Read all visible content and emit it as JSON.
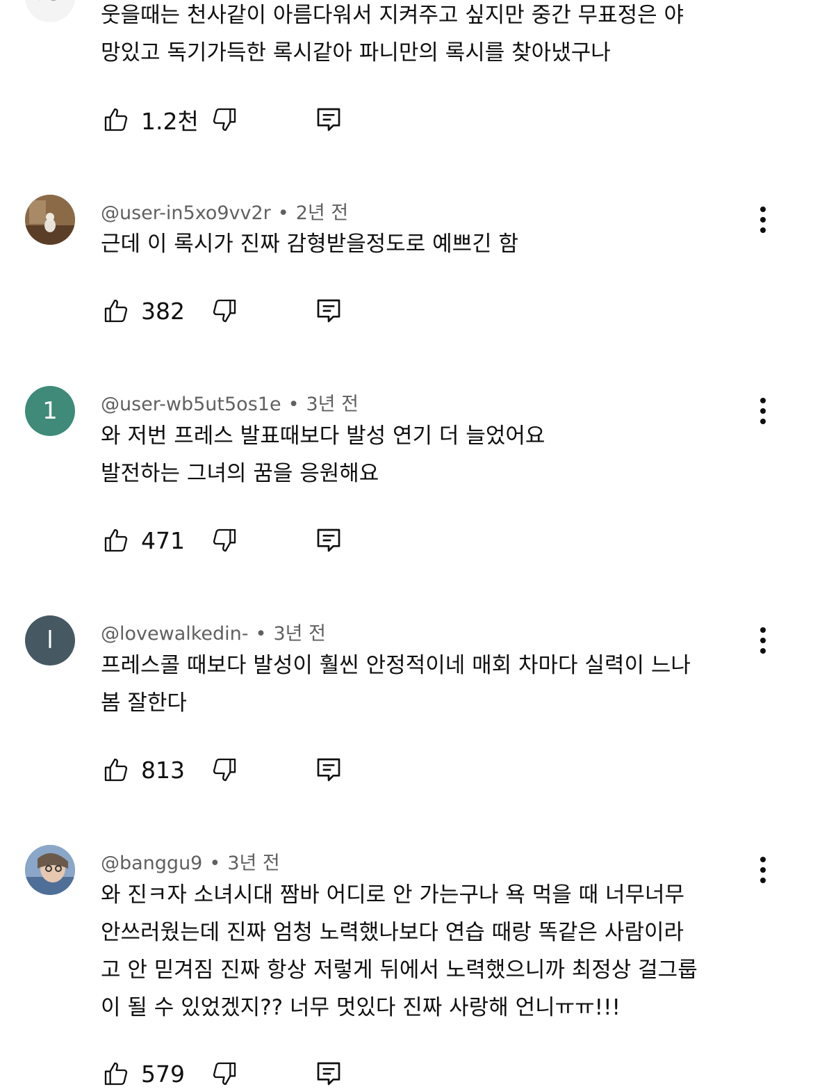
{
  "comments": [
    {
      "author": "",
      "time": "",
      "lines": [
        "웃을때는 천사같이 아름다워서 지켜주고 싶지만 중간 무표정은 야",
        "망있고 독기가득한 록시같아 파니만의 록시를 찾아냈구나"
      ],
      "likes": "1.2천"
    },
    {
      "author": "@user-in5xo9vv2r",
      "time": "2년 전",
      "lines": [
        "근데 이 록시가 진짜 감형받을정도로 예쁘긴 함"
      ],
      "likes": "382"
    },
    {
      "author": "@user-wb5ut5os1e",
      "time": "3년 전",
      "avatar_letter": "1",
      "avatar_color": "#3f8a78",
      "lines": [
        "와 저번 프레스 발표때보다 발성 연기 더 늘었어요",
        "발전하는 그녀의 꿈을 응원해요"
      ],
      "likes": "471"
    },
    {
      "author": "@lovewalkedin-",
      "time": "3년 전",
      "avatar_letter": "l",
      "avatar_color": "#465861",
      "lines": [
        "프레스콜 때보다 발성이 훨씬 안정적이네 매회 차마다 실력이 느나",
        "봄 잘한다"
      ],
      "likes": "813"
    },
    {
      "author": "@banggu9",
      "time": "3년 전",
      "lines": [
        "와 진ㅋ자 소녀시대 짬바 어디로 안 가는구나 욕 먹을 때 너무너무",
        "안쓰러웠는데 진짜 엄청 노력했나보다 연습 때랑 똑같은 사람이라",
        "고 안 믿겨짐 진짜 항상 저렇게 뒤에서 노력했으니까 최정상 걸그룹",
        "이 될 수 있었겠지?? 너무 멋있다 진짜 사랑해 언니ㅠㅠ!!!"
      ],
      "likes": "579"
    }
  ],
  "separator": "•"
}
